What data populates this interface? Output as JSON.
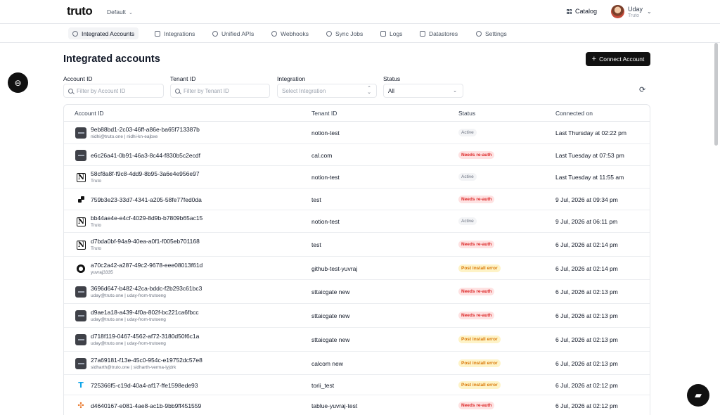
{
  "topbar": {
    "brand": "truto",
    "workspace": "Default",
    "catalog_label": "Catalog",
    "user_name": "Uday",
    "user_org": "Truto"
  },
  "nav": [
    {
      "label": "Integrated Accounts",
      "icon": "cloud-icon",
      "active": true
    },
    {
      "label": "Integrations",
      "icon": "grid-icon",
      "active": false
    },
    {
      "label": "Unified APIs",
      "icon": "globe-icon",
      "active": false
    },
    {
      "label": "Webhooks",
      "icon": "webhook-icon",
      "active": false
    },
    {
      "label": "Sync Jobs",
      "icon": "sync-icon",
      "active": false
    },
    {
      "label": "Logs",
      "icon": "list-icon",
      "active": false
    },
    {
      "label": "Datastores",
      "icon": "database-icon",
      "active": false
    },
    {
      "label": "Settings",
      "icon": "gear-icon",
      "active": false
    }
  ],
  "page": {
    "title": "Integrated accounts",
    "connect_label": "Connect Account"
  },
  "filters": {
    "account_label": "Account ID",
    "account_placeholder": "Filter by Account ID",
    "tenant_label": "Tenant ID",
    "tenant_placeholder": "Filter by Tenant ID",
    "integration_label": "Integration",
    "integration_placeholder": "Select Integration",
    "status_label": "Status",
    "status_value": "All"
  },
  "table": {
    "headers": {
      "account": "Account ID",
      "tenant": "Tenant ID",
      "status": "Status",
      "connected": "Connected on"
    },
    "rows": [
      {
        "logo": "dark",
        "id": "9eb88bd1-2c03-46ff-a86e-ba65f713387b",
        "sub": "nidhi@truto.one | nidhi-kn-eajbxe",
        "tenant": "notion-test",
        "status": "Active",
        "kind": "active",
        "connected": "Last Thursday at 02:22 pm"
      },
      {
        "logo": "dark",
        "id": "e6c26a41-0b91-46a3-8c44-f830b5c2ecdf",
        "sub": "",
        "tenant": "cal.com",
        "status": "Needs re-auth",
        "kind": "reauth",
        "connected": "Last Tuesday at 07:53 pm"
      },
      {
        "logo": "notion",
        "id": "58cf8a8f-f9c8-4dd9-8b95-3a6e4e956e97",
        "sub": "Truto",
        "tenant": "notion-test",
        "status": "Active",
        "kind": "active",
        "connected": "Last Tuesday at 11:55 am"
      },
      {
        "logo": "cal",
        "id": "759b3e23-33d7-4341-a205-58fe77fed0da",
        "sub": "",
        "tenant": "test",
        "status": "Needs re-auth",
        "kind": "reauth",
        "connected": "9 Jul, 2026 at 09:34 pm"
      },
      {
        "logo": "notion",
        "id": "bb44ae4e-e4cf-4029-8d9b-b7809b65ac15",
        "sub": "Truto",
        "tenant": "notion-test",
        "status": "Active",
        "kind": "active",
        "connected": "9 Jul, 2026 at 06:11 pm"
      },
      {
        "logo": "notion",
        "id": "d7bda0bf-94a9-40ea-a0f1-f005eb701168",
        "sub": "Truto",
        "tenant": "test",
        "status": "Needs re-auth",
        "kind": "reauth",
        "connected": "6 Jul, 2026 at 02:14 pm"
      },
      {
        "logo": "gh",
        "id": "a70c2a42-a287-49c2-9678-eee08013f61d",
        "sub": "yuvraj3335",
        "tenant": "github-test-yuvraj",
        "status": "Post install error",
        "kind": "post",
        "connected": "6 Jul, 2026 at 02:14 pm"
      },
      {
        "logo": "dark",
        "id": "3696d647-b482-42ca-bddc-f2b293c61bc3",
        "sub": "uday@truto.one | uday-from-trutoeng",
        "tenant": "sttaicgate new",
        "status": "Needs re-auth",
        "kind": "reauth",
        "connected": "6 Jul, 2026 at 02:13 pm"
      },
      {
        "logo": "dark",
        "id": "d9ae1a18-a439-4f0a-802f-bc221ca6fbcc",
        "sub": "uday@truto.one | uday-from-trutoeng",
        "tenant": "sttaicgate new",
        "status": "Needs re-auth",
        "kind": "reauth",
        "connected": "6 Jul, 2026 at 02:13 pm"
      },
      {
        "logo": "dark",
        "id": "d718f119-0467-4562-af72-3180d50f6c1a",
        "sub": "uday@truto.one | uday-from-trutoeng",
        "tenant": "sttaicgate new",
        "status": "Post install error",
        "kind": "post",
        "connected": "6 Jul, 2026 at 02:13 pm"
      },
      {
        "logo": "dark",
        "id": "27a69181-f13e-45c0-954c-e19752dc57e8",
        "sub": "sidharth@truto.one | sidharth-verma-lyjdrk",
        "tenant": "calcom new",
        "status": "Post install error",
        "kind": "post",
        "connected": "6 Jul, 2026 at 02:13 pm"
      },
      {
        "logo": "torii",
        "id": "725366f5-c19d-40a4-af17-ffe1598ede93",
        "sub": "",
        "tenant": "torii_test",
        "status": "Post install error",
        "kind": "post",
        "connected": "6 Jul, 2026 at 02:12 pm"
      },
      {
        "logo": "tab",
        "id": "d4640167-e081-4ae8-ac1b-9bb9ff451559",
        "sub": "",
        "tenant": "tablue-yuvraj-test",
        "status": "Needs re-auth",
        "kind": "reauth",
        "connected": "6 Jul, 2026 at 02:12 pm"
      }
    ]
  }
}
